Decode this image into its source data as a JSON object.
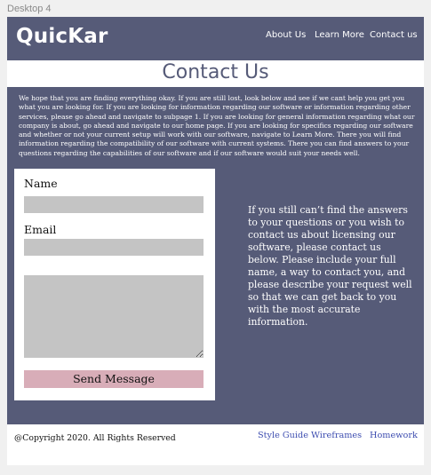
{
  "frame_label": "Desktop 4",
  "header": {
    "logo": "QuicKar",
    "nav": {
      "about": "About Us",
      "learn_more": "Learn More",
      "contact": "Contact us"
    }
  },
  "page_title": "Contact Us",
  "intro_text": "We hope that you are finding everything okay. If you are still lost, look below and see if we cant help you get you what you are looking for. If you are looking for information regarding our software or information regarding other services, please go ahead and navigate to subpage 1. If you are looking for general information regarding what our company is about, go ahead and navigate to our home page. If you are looking for specifics regarding our software and whether or not your current setup will work with our software, navigate to Learn More. There you will find information regarding the compatibility of our software with current systems. There you can find answers to your questions regarding the capabilities of our software and if our software would suit your needs well.",
  "form": {
    "name_label": "Name",
    "name_value": "",
    "email_label": "Email",
    "email_value": "",
    "message_value": "",
    "send_label": "Send Message"
  },
  "side_text": "If you still can’t find the answers to your questions or you wish to contact us about licensing our software, please contact us below. Please include your full name, a way to contact you, and please describe your request well so that we can get back to you with the most accurate information.",
  "footer": {
    "copyright": "@Copyright 2020. All Rights Reserved",
    "links": {
      "style_guide": "Style Guide",
      "wireframes": "Wireframes",
      "homework": "Homework"
    }
  },
  "colors": {
    "brand": "#565b78",
    "button": "#d8adb8",
    "input": "#c4c4c4",
    "link": "#3d4db0"
  }
}
